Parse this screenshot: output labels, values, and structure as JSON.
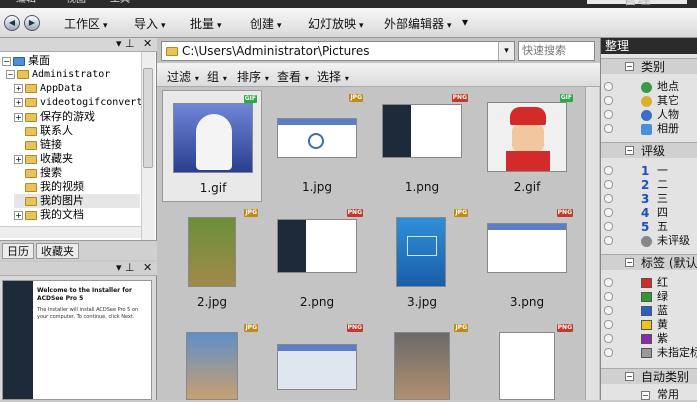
{
  "menubar": {
    "items": [
      "编辑",
      "视图",
      "工具"
    ],
    "brand": "管理"
  },
  "toolbar": {
    "items": [
      {
        "label": "工作区",
        "has_menu": true
      },
      {
        "label": "导入",
        "has_menu": true
      },
      {
        "label": "批量",
        "has_menu": true
      },
      {
        "label": "创建",
        "has_menu": true
      },
      {
        "label": "幻灯放映",
        "has_menu": true
      },
      {
        "label": "外部编辑器",
        "has_menu": true
      }
    ],
    "more": "▾"
  },
  "tree": {
    "items": [
      {
        "label": "桌面",
        "expander": "−"
      },
      {
        "label": "Administrator",
        "expander": "−"
      },
      {
        "label": "AppData",
        "expander": "+"
      },
      {
        "label": "videotogifconverte",
        "expander": "+"
      },
      {
        "label": "保存的游戏",
        "expander": "+"
      },
      {
        "label": "联系人",
        "expander": ""
      },
      {
        "label": "链接",
        "expander": ""
      },
      {
        "label": "收藏夹",
        "expander": "+"
      },
      {
        "label": "搜索",
        "expander": ""
      },
      {
        "label": "我的视频",
        "expander": ""
      },
      {
        "label": "我的图片",
        "expander": ""
      },
      {
        "label": "我的文档",
        "expander": "+"
      }
    ],
    "tabs": [
      "日历",
      "收藏夹"
    ]
  },
  "preview": {
    "caption": "Welcome to the Installer for ACDSee Pro 5",
    "body": "The Installer will install ACDSee Pro 5 on your computer. To continue, click Next."
  },
  "address": {
    "path": "C:\\Users\\Administrator\\Pictures",
    "search_placeholder": "快速搜索"
  },
  "commands": [
    "过滤",
    "组",
    "排序",
    "查看",
    "选择"
  ],
  "files": [
    {
      "name": "1.gif",
      "type": "GIF",
      "selected": true
    },
    {
      "name": "1.jpg",
      "type": "JPG"
    },
    {
      "name": "1.png",
      "type": "PNG"
    },
    {
      "name": "2.gif",
      "type": "GIF"
    },
    {
      "name": "2.jpg",
      "type": "JPG"
    },
    {
      "name": "2.png",
      "type": "PNG"
    },
    {
      "name": "3.jpg",
      "type": "JPG"
    },
    {
      "name": "3.png",
      "type": "PNG"
    },
    {
      "name": "",
      "type": "JPG"
    },
    {
      "name": "",
      "type": "PNG"
    },
    {
      "name": "",
      "type": "JPG"
    },
    {
      "name": "",
      "type": "PNG"
    }
  ],
  "organize": {
    "title": "整理",
    "category": {
      "title": "类别",
      "items": [
        "地点",
        "其它",
        "人物",
        "相册"
      ]
    },
    "rating": {
      "title": "评级",
      "items": [
        {
          "num": "1",
          "label": "一"
        },
        {
          "num": "2",
          "label": "二"
        },
        {
          "num": "3",
          "label": "三"
        },
        {
          "num": "4",
          "label": "四"
        },
        {
          "num": "5",
          "label": "五"
        },
        {
          "num": "",
          "label": "未评级"
        }
      ]
    },
    "labels": {
      "title": "标签 (默认)",
      "items": [
        {
          "label": "红",
          "color": "#d42a2a"
        },
        {
          "label": "绿",
          "color": "#2e9a2e"
        },
        {
          "label": "蓝",
          "color": "#2860c8"
        },
        {
          "label": "黄",
          "color": "#e8c820"
        },
        {
          "label": "紫",
          "color": "#8a2ab0"
        },
        {
          "label": "未指定标",
          "color": "#999999"
        }
      ]
    },
    "auto": {
      "title": "自动类别"
    },
    "common": {
      "title": "常用"
    }
  },
  "colors": {
    "gif_badge": "#2aa84a",
    "jpg_badge": "#c08a1a",
    "png_badge": "#c43a2a"
  }
}
